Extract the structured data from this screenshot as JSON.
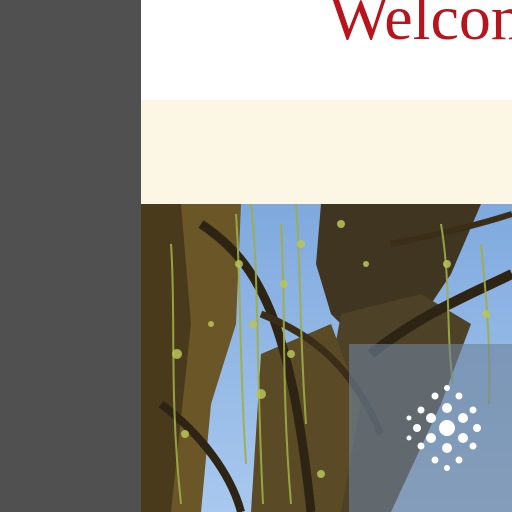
{
  "page": {
    "title": "Welcome"
  },
  "colors": {
    "sidebar": "#505050",
    "title_text": "#b8141e",
    "banner": "#fcf6e4",
    "overlay": "#6e829b",
    "sky": "#8fb6e6"
  },
  "icons": {
    "logo": "dotted-circle-logo-icon"
  }
}
